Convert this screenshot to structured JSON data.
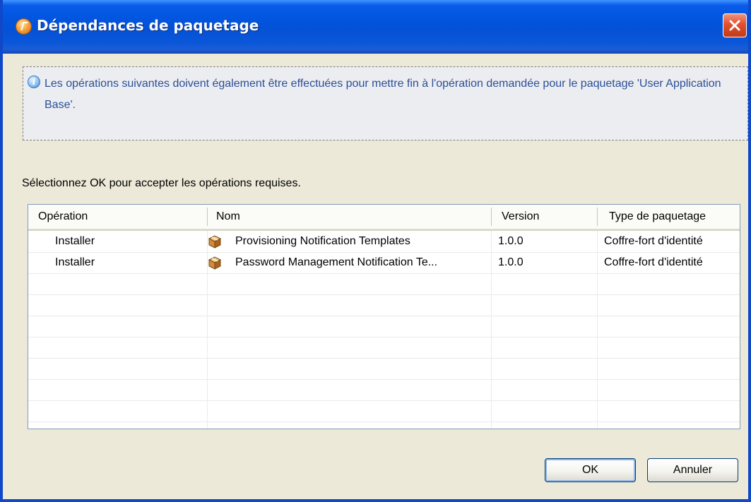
{
  "window": {
    "title": "Dépendances de paquetage"
  },
  "info": {
    "icon": "info-icon",
    "message": "Les opérations suivantes doivent également être effectuées pour mettre fin à l'opération demandée pour le paquetage 'User Application Base'."
  },
  "instruction": "Sélectionnez OK pour accepter les opérations requises.",
  "table": {
    "columns": [
      "Opération",
      "Nom",
      "Version",
      "Type de paquetage"
    ],
    "rows": [
      {
        "operation": "Installer",
        "name": "Provisioning Notification Templates",
        "version": "1.0.0",
        "type": "Coffre-fort d'identité",
        "icon": "package-icon"
      },
      {
        "operation": "Installer",
        "name": "Password Management Notification Te...",
        "version": "1.0.0",
        "type": "Coffre-fort d'identité",
        "icon": "package-icon"
      }
    ]
  },
  "buttons": {
    "ok": "OK",
    "cancel": "Annuler"
  },
  "colors": {
    "titlebar": "#0451d6",
    "info_text": "#2a4f96",
    "dialog_bg": "#ece9d8"
  }
}
